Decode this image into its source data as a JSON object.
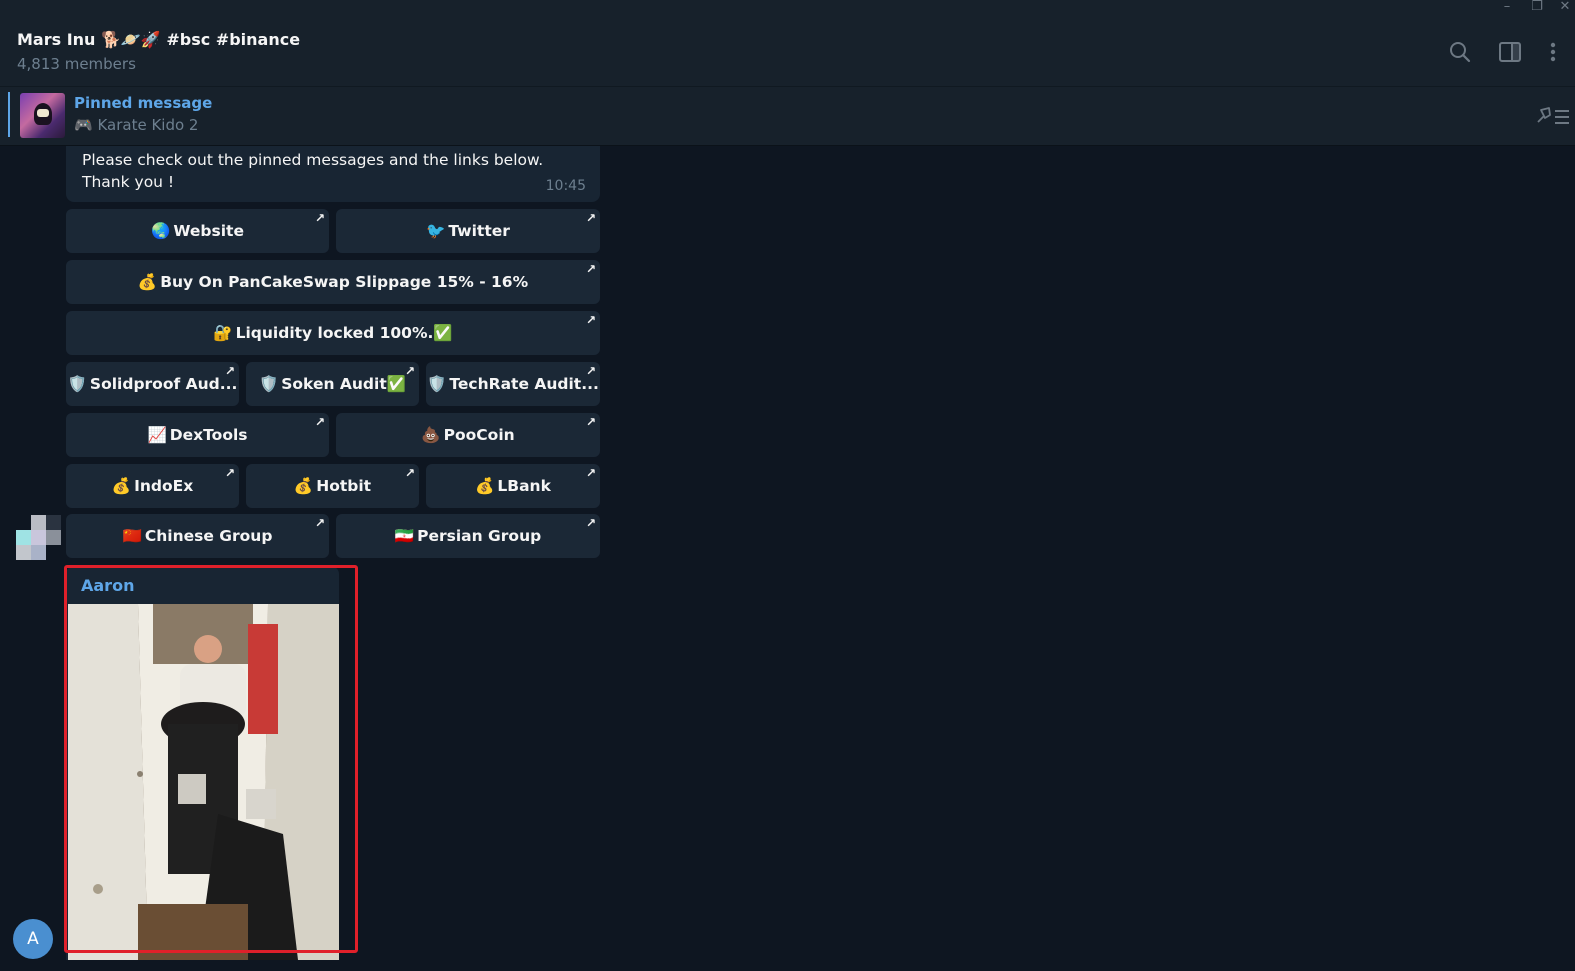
{
  "window": {
    "minimize": "–",
    "restore": "❐",
    "close": "✕"
  },
  "header": {
    "title": "Mars Inu 🐕🪐🚀 #bsc #binance",
    "members": "4,813 members",
    "icons": [
      "search-icon",
      "sidebar-toggle-icon",
      "more-vertical-icon"
    ]
  },
  "pinned": {
    "title": "Pinned message",
    "text": "🎮 Karate Kido 2"
  },
  "message": {
    "text": "Please check out the pinned messages and the links below. Thank you !",
    "time": "10:45"
  },
  "keyboard": {
    "website": {
      "emoji": "🌏",
      "label": "Website"
    },
    "twitter": {
      "emoji": "🐦",
      "label": "Twitter"
    },
    "pancake": {
      "emoji": "💰",
      "label": "Buy On PanCakeSwap Slippage 15% - 16%"
    },
    "liquidity": {
      "emoji": "🔐",
      "label": "Liquidity locked 100%.✅"
    },
    "solidproof": {
      "emoji": "🛡️",
      "label": "Solidproof Aud..."
    },
    "soken": {
      "emoji": "🛡️",
      "label": "Soken Audit✅"
    },
    "techrate": {
      "emoji": "🛡️",
      "label": "TechRate Audit..."
    },
    "dextools": {
      "emoji": "📈",
      "label": "DexTools"
    },
    "poocoin": {
      "emoji": "💩",
      "label": "PooCoin"
    },
    "indoex": {
      "emoji": "💰",
      "label": "IndoEx"
    },
    "hotbit": {
      "emoji": "💰",
      "label": "Hotbit"
    },
    "lbank": {
      "emoji": "💰",
      "label": "LBank"
    },
    "chinese": {
      "emoji": "🇨🇳",
      "label": "Chinese Group"
    },
    "persian": {
      "emoji": "🇮🇷",
      "label": "Persian Group"
    },
    "arrow": "↗"
  },
  "gif_message": {
    "sender": "Aaron"
  },
  "user_avatar": {
    "initial": "A",
    "color": "#4a8fd0"
  },
  "colors": {
    "background": "#0e1621",
    "panel": "#17212b",
    "bubble": "#182533",
    "accent": "#5ea6e8",
    "highlight": "#e0202a"
  }
}
